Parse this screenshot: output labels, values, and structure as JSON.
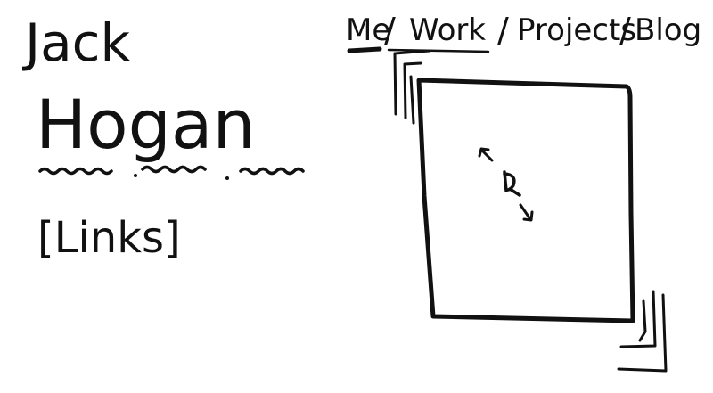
{
  "header": {
    "first_name": "Jack",
    "last_name": "Hogan",
    "links_label": "[Links]"
  },
  "nav": {
    "items": [
      {
        "label": "Me"
      },
      {
        "label": "Work"
      },
      {
        "label": "Projects"
      },
      {
        "label": "Blog"
      }
    ],
    "separator": "/",
    "active": "Me"
  },
  "main": {
    "panel_icon": "resize-icon"
  },
  "colors": {
    "ink": "#111111",
    "background": "#ffffff"
  }
}
